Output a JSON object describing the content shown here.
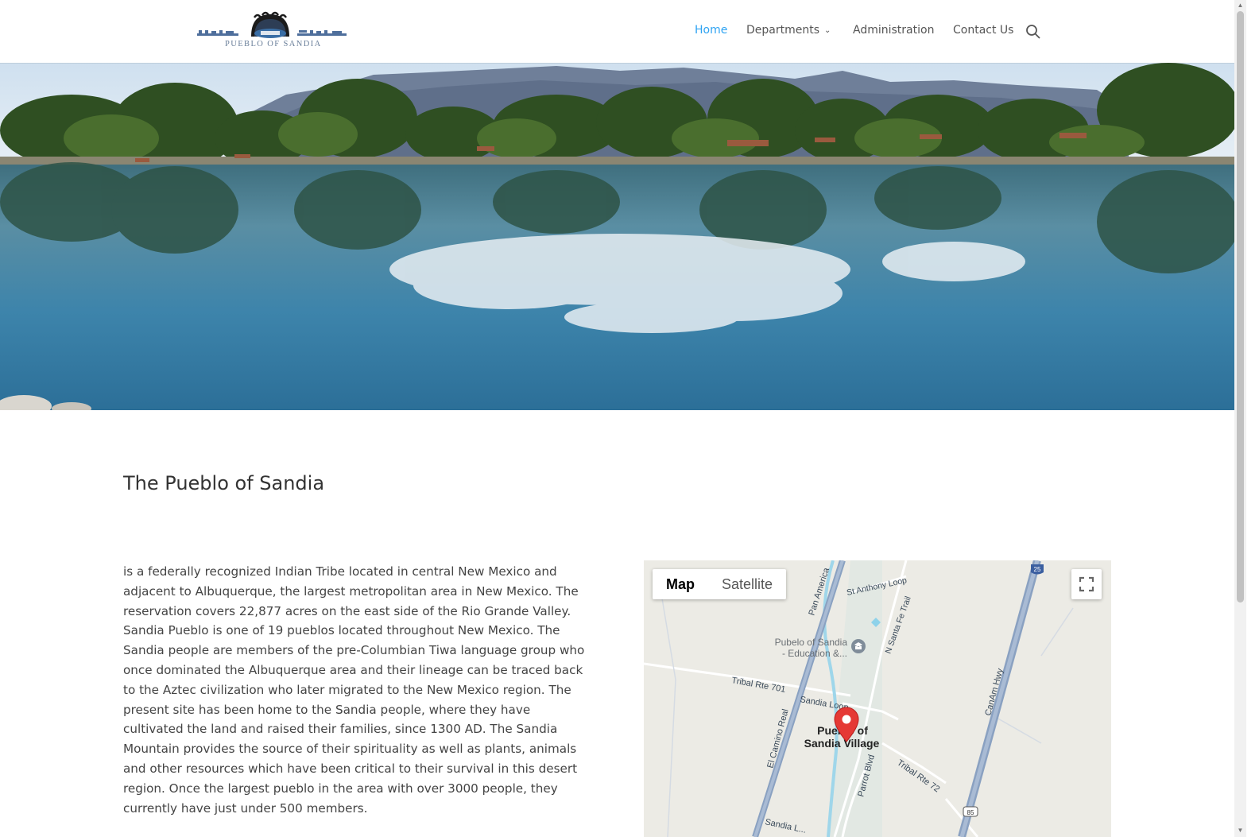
{
  "header": {
    "logo_text": "PUEBLO OF SANDIA",
    "nav": [
      {
        "label": "Home",
        "active": true
      },
      {
        "label": "Departments",
        "has_dropdown": true
      },
      {
        "label": "Administration"
      },
      {
        "label": "Contact Us"
      }
    ],
    "search_icon": "search-icon",
    "accent_color": "#2ea3f2"
  },
  "hero": {
    "image": "lake-with-trees-and-mountain-reflection"
  },
  "main": {
    "title": "The Pueblo of Sandia",
    "body": "is a federally recognized Indian Tribe located in central New Mexico and adjacent to Albuquerque, the largest metropolitan area in New Mexico. The reservation covers 22,877 acres on the east side of the Rio Grande Valley. Sandia Pueblo is one of 19 pueblos located throughout New Mexico. The Sandia people are members of the pre-Columbian Tiwa language group who once dominated the Albuquerque area and their lineage can be traced back to the Aztec civilization who later migrated to the New Mexico region. The present site has been home to the Sandia people, where they have cultivated the land and raised their families, since 1300 AD. The Sandia Mountain provides the source of their spirituality as well as plants, animals and other resources which have been critical to their survival in this desert region. Once the largest pueblo in the area with over 3000 people, they currently have just under 500 members."
  },
  "map": {
    "type_buttons": {
      "map": "Map",
      "satellite": "Satellite"
    },
    "selected_type": "Map",
    "fullscreen_icon": "fullscreen-icon",
    "labels": {
      "pan_america": "Pan America",
      "st_anthony": "St Anthony Loop",
      "santa_fe_trail": "N Santa Fe Trail",
      "school_line1": "Pubelo of Sandia",
      "school_line2": "- Education &...",
      "tribal_701": "Tribal Rte 701",
      "sandia_loop": "Sandia Loop",
      "camino_real": "El Camino Real",
      "village_line1": "Pueblo of",
      "village_line2": "Sandia Village",
      "parrot_blvd": "Parrot Blvd",
      "tribal_72": "Tribal Rte 72",
      "canam_hwy": "CanAm Hwy",
      "sandia_bottom": "Sandia L...",
      "shield_25": "25",
      "shield_85": "85"
    }
  }
}
